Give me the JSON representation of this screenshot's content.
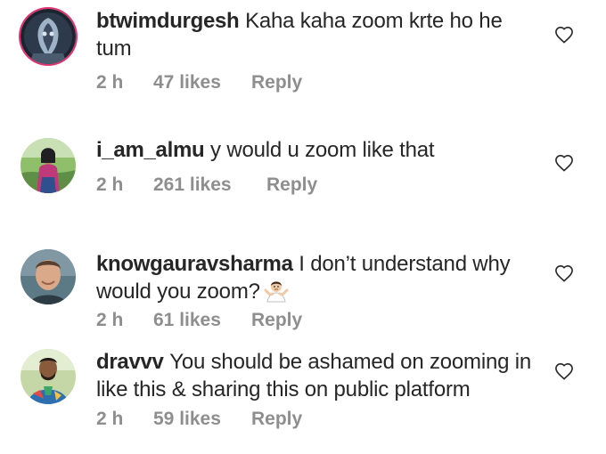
{
  "comments": [
    {
      "username": "btwimdurgesh",
      "text": "Kaha kaha zoom krte ho he tum",
      "time": "2 h",
      "likes": "47 likes",
      "reply": "Reply",
      "avatar": "dark-figure-with-story-ring"
    },
    {
      "username": "i_am_almu",
      "text": "y would u zoom like that",
      "time": "2 h",
      "likes": "261 likes",
      "reply": "Reply",
      "avatar": "woman-outdoors"
    },
    {
      "username": "knowgauravsharma",
      "text": "I don’t understand why would you zoom?",
      "time": "2 h",
      "likes": "61 likes",
      "reply": "Reply",
      "avatar": "man-selfie",
      "emoji": "person-shrugging"
    },
    {
      "username": "dravvv",
      "text": "You should be ashamed on zooming in like this & sharing this on public platform",
      "time": "2 h",
      "likes": "59 likes",
      "reply": "Reply",
      "avatar": "man-colorful-shirt"
    }
  ],
  "icons": {
    "like": "heart-outline-icon"
  },
  "colors": {
    "text": "#262626",
    "meta": "#8e8e8e",
    "story_ring": "#e0336f"
  }
}
